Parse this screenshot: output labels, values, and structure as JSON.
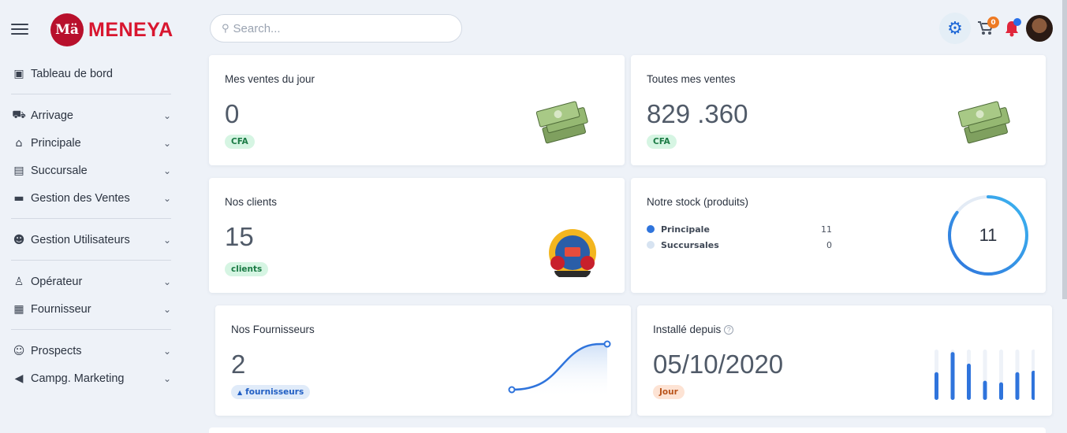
{
  "app": {
    "logo_mark": "Mä",
    "name": "MENEYA"
  },
  "search": {
    "placeholder": "Search..."
  },
  "header": {
    "cart_count": "0"
  },
  "sidebar": {
    "items": [
      {
        "label": "Tableau de bord",
        "icon": "dashboard-icon",
        "glyph": "▣",
        "chevron": false,
        "sep_after": true
      },
      {
        "label": "Arrivage",
        "icon": "truck-icon",
        "glyph": "⛟",
        "chevron": true,
        "sep_after": false
      },
      {
        "label": "Principale",
        "icon": "home-icon",
        "glyph": "⌂",
        "chevron": true,
        "sep_after": false
      },
      {
        "label": "Succursale",
        "icon": "store-icon",
        "glyph": "▤",
        "chevron": true,
        "sep_after": false
      },
      {
        "label": "Gestion des Ventes",
        "icon": "money-icon",
        "glyph": "▬",
        "chevron": true,
        "sep_after": true
      },
      {
        "label": "Gestion Utilisateurs",
        "icon": "users-icon",
        "glyph": "☻",
        "chevron": true,
        "sep_after": true
      },
      {
        "label": "Opérateur",
        "icon": "user-tie-icon",
        "glyph": "♙",
        "chevron": true,
        "sep_after": false
      },
      {
        "label": "Fournisseur",
        "icon": "briefcase-icon",
        "glyph": "▦",
        "chevron": true,
        "sep_after": true
      },
      {
        "label": "Prospects",
        "icon": "smile-icon",
        "glyph": "☺",
        "chevron": true,
        "sep_after": false
      },
      {
        "label": "Campg. Marketing",
        "icon": "megaphone-icon",
        "glyph": "◀",
        "chevron": true,
        "sep_after": false
      }
    ]
  },
  "cards": {
    "sales_today": {
      "title": "Mes ventes du jour",
      "value": "0",
      "badge": "CFA"
    },
    "all_sales": {
      "title": "Toutes mes ventes",
      "value": "829 .360",
      "badge": "CFA"
    },
    "clients": {
      "title": "Nos clients",
      "value": "15",
      "badge": "clients"
    },
    "stock": {
      "title": "Notre stock (produits)",
      "total": "11",
      "legend": [
        {
          "name": "Principale",
          "value": "11",
          "color": "#2f74dc"
        },
        {
          "name": "Succursales",
          "value": "0",
          "color": "#d7e3f1"
        }
      ],
      "fill_fraction": 0.85
    },
    "suppliers": {
      "title": "Nos Fournisseurs",
      "value": "2",
      "badge": "fournisseurs"
    },
    "installed": {
      "title": "Installé depuis",
      "value": "05/10/2020",
      "badge": "Jour",
      "bars": [
        0.55,
        0.95,
        0.72,
        0.38,
        0.35,
        0.55,
        0.58
      ]
    }
  },
  "colors": {
    "brand": "#d8162f",
    "accent": "#2f74dc"
  }
}
